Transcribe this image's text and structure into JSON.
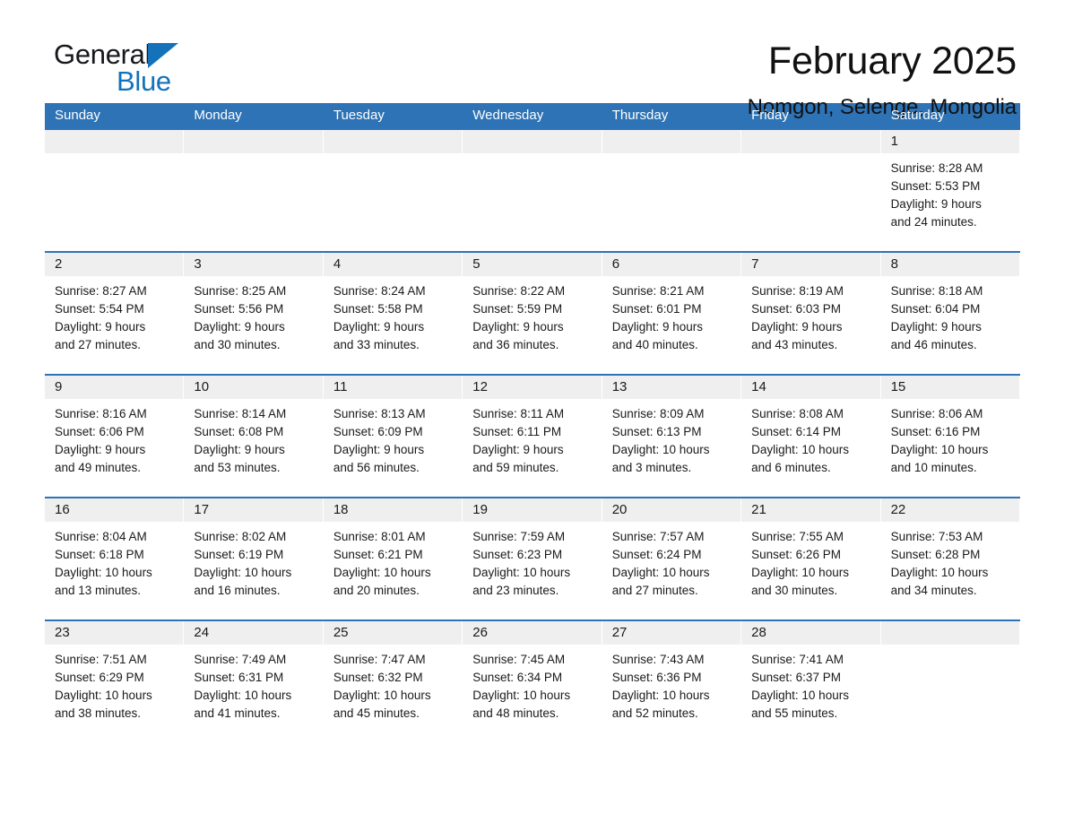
{
  "brand": {
    "name_part1": "General",
    "name_part2": "Blue",
    "logo_icon": "blue-triangle-logo"
  },
  "header": {
    "title": "February 2025",
    "subtitle": "Nomgon, Selenge, Mongolia"
  },
  "colors": {
    "header_blue": "#2e73b5",
    "brand_blue": "#1472bb",
    "day_band_gray": "#efefef"
  },
  "weekdays": [
    "Sunday",
    "Monday",
    "Tuesday",
    "Wednesday",
    "Thursday",
    "Friday",
    "Saturday"
  ],
  "weeks": [
    [
      {
        "day": "",
        "sunrise": "",
        "sunset": "",
        "daylight1": "",
        "daylight2": ""
      },
      {
        "day": "",
        "sunrise": "",
        "sunset": "",
        "daylight1": "",
        "daylight2": ""
      },
      {
        "day": "",
        "sunrise": "",
        "sunset": "",
        "daylight1": "",
        "daylight2": ""
      },
      {
        "day": "",
        "sunrise": "",
        "sunset": "",
        "daylight1": "",
        "daylight2": ""
      },
      {
        "day": "",
        "sunrise": "",
        "sunset": "",
        "daylight1": "",
        "daylight2": ""
      },
      {
        "day": "",
        "sunrise": "",
        "sunset": "",
        "daylight1": "",
        "daylight2": ""
      },
      {
        "day": "1",
        "sunrise": "Sunrise: 8:28 AM",
        "sunset": "Sunset: 5:53 PM",
        "daylight1": "Daylight: 9 hours",
        "daylight2": "and 24 minutes."
      }
    ],
    [
      {
        "day": "2",
        "sunrise": "Sunrise: 8:27 AM",
        "sunset": "Sunset: 5:54 PM",
        "daylight1": "Daylight: 9 hours",
        "daylight2": "and 27 minutes."
      },
      {
        "day": "3",
        "sunrise": "Sunrise: 8:25 AM",
        "sunset": "Sunset: 5:56 PM",
        "daylight1": "Daylight: 9 hours",
        "daylight2": "and 30 minutes."
      },
      {
        "day": "4",
        "sunrise": "Sunrise: 8:24 AM",
        "sunset": "Sunset: 5:58 PM",
        "daylight1": "Daylight: 9 hours",
        "daylight2": "and 33 minutes."
      },
      {
        "day": "5",
        "sunrise": "Sunrise: 8:22 AM",
        "sunset": "Sunset: 5:59 PM",
        "daylight1": "Daylight: 9 hours",
        "daylight2": "and 36 minutes."
      },
      {
        "day": "6",
        "sunrise": "Sunrise: 8:21 AM",
        "sunset": "Sunset: 6:01 PM",
        "daylight1": "Daylight: 9 hours",
        "daylight2": "and 40 minutes."
      },
      {
        "day": "7",
        "sunrise": "Sunrise: 8:19 AM",
        "sunset": "Sunset: 6:03 PM",
        "daylight1": "Daylight: 9 hours",
        "daylight2": "and 43 minutes."
      },
      {
        "day": "8",
        "sunrise": "Sunrise: 8:18 AM",
        "sunset": "Sunset: 6:04 PM",
        "daylight1": "Daylight: 9 hours",
        "daylight2": "and 46 minutes."
      }
    ],
    [
      {
        "day": "9",
        "sunrise": "Sunrise: 8:16 AM",
        "sunset": "Sunset: 6:06 PM",
        "daylight1": "Daylight: 9 hours",
        "daylight2": "and 49 minutes."
      },
      {
        "day": "10",
        "sunrise": "Sunrise: 8:14 AM",
        "sunset": "Sunset: 6:08 PM",
        "daylight1": "Daylight: 9 hours",
        "daylight2": "and 53 minutes."
      },
      {
        "day": "11",
        "sunrise": "Sunrise: 8:13 AM",
        "sunset": "Sunset: 6:09 PM",
        "daylight1": "Daylight: 9 hours",
        "daylight2": "and 56 minutes."
      },
      {
        "day": "12",
        "sunrise": "Sunrise: 8:11 AM",
        "sunset": "Sunset: 6:11 PM",
        "daylight1": "Daylight: 9 hours",
        "daylight2": "and 59 minutes."
      },
      {
        "day": "13",
        "sunrise": "Sunrise: 8:09 AM",
        "sunset": "Sunset: 6:13 PM",
        "daylight1": "Daylight: 10 hours",
        "daylight2": "and 3 minutes."
      },
      {
        "day": "14",
        "sunrise": "Sunrise: 8:08 AM",
        "sunset": "Sunset: 6:14 PM",
        "daylight1": "Daylight: 10 hours",
        "daylight2": "and 6 minutes."
      },
      {
        "day": "15",
        "sunrise": "Sunrise: 8:06 AM",
        "sunset": "Sunset: 6:16 PM",
        "daylight1": "Daylight: 10 hours",
        "daylight2": "and 10 minutes."
      }
    ],
    [
      {
        "day": "16",
        "sunrise": "Sunrise: 8:04 AM",
        "sunset": "Sunset: 6:18 PM",
        "daylight1": "Daylight: 10 hours",
        "daylight2": "and 13 minutes."
      },
      {
        "day": "17",
        "sunrise": "Sunrise: 8:02 AM",
        "sunset": "Sunset: 6:19 PM",
        "daylight1": "Daylight: 10 hours",
        "daylight2": "and 16 minutes."
      },
      {
        "day": "18",
        "sunrise": "Sunrise: 8:01 AM",
        "sunset": "Sunset: 6:21 PM",
        "daylight1": "Daylight: 10 hours",
        "daylight2": "and 20 minutes."
      },
      {
        "day": "19",
        "sunrise": "Sunrise: 7:59 AM",
        "sunset": "Sunset: 6:23 PM",
        "daylight1": "Daylight: 10 hours",
        "daylight2": "and 23 minutes."
      },
      {
        "day": "20",
        "sunrise": "Sunrise: 7:57 AM",
        "sunset": "Sunset: 6:24 PM",
        "daylight1": "Daylight: 10 hours",
        "daylight2": "and 27 minutes."
      },
      {
        "day": "21",
        "sunrise": "Sunrise: 7:55 AM",
        "sunset": "Sunset: 6:26 PM",
        "daylight1": "Daylight: 10 hours",
        "daylight2": "and 30 minutes."
      },
      {
        "day": "22",
        "sunrise": "Sunrise: 7:53 AM",
        "sunset": "Sunset: 6:28 PM",
        "daylight1": "Daylight: 10 hours",
        "daylight2": "and 34 minutes."
      }
    ],
    [
      {
        "day": "23",
        "sunrise": "Sunrise: 7:51 AM",
        "sunset": "Sunset: 6:29 PM",
        "daylight1": "Daylight: 10 hours",
        "daylight2": "and 38 minutes."
      },
      {
        "day": "24",
        "sunrise": "Sunrise: 7:49 AM",
        "sunset": "Sunset: 6:31 PM",
        "daylight1": "Daylight: 10 hours",
        "daylight2": "and 41 minutes."
      },
      {
        "day": "25",
        "sunrise": "Sunrise: 7:47 AM",
        "sunset": "Sunset: 6:32 PM",
        "daylight1": "Daylight: 10 hours",
        "daylight2": "and 45 minutes."
      },
      {
        "day": "26",
        "sunrise": "Sunrise: 7:45 AM",
        "sunset": "Sunset: 6:34 PM",
        "daylight1": "Daylight: 10 hours",
        "daylight2": "and 48 minutes."
      },
      {
        "day": "27",
        "sunrise": "Sunrise: 7:43 AM",
        "sunset": "Sunset: 6:36 PM",
        "daylight1": "Daylight: 10 hours",
        "daylight2": "and 52 minutes."
      },
      {
        "day": "28",
        "sunrise": "Sunrise: 7:41 AM",
        "sunset": "Sunset: 6:37 PM",
        "daylight1": "Daylight: 10 hours",
        "daylight2": "and 55 minutes."
      },
      {
        "day": "",
        "sunrise": "",
        "sunset": "",
        "daylight1": "",
        "daylight2": ""
      }
    ]
  ]
}
